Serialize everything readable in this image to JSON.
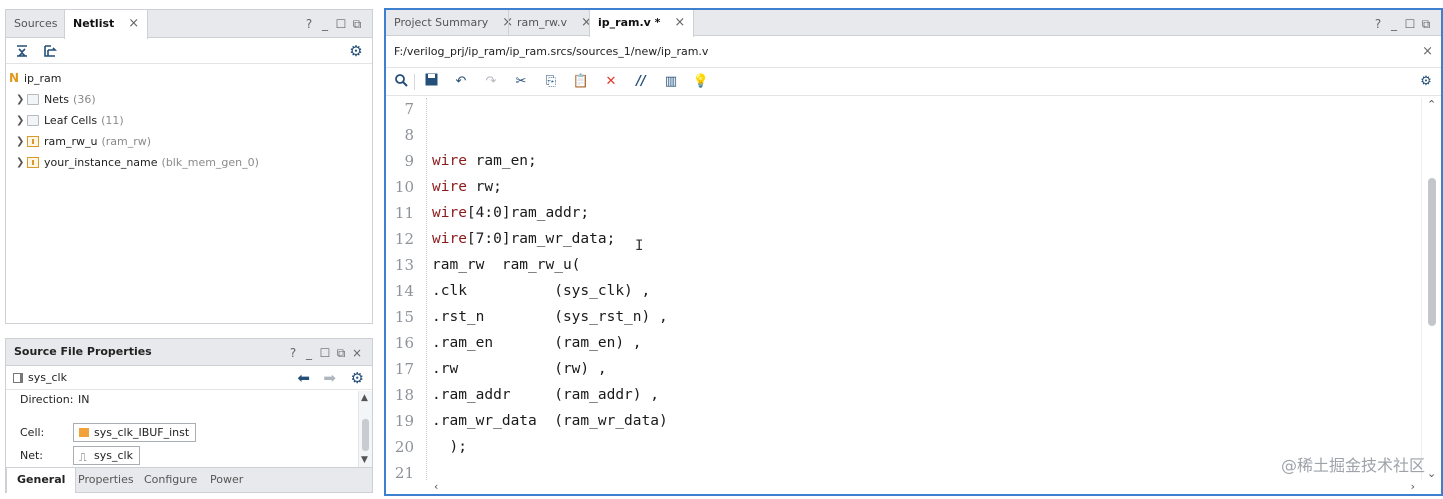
{
  "left_top": {
    "tabs": [
      {
        "label": "Sources"
      },
      {
        "label": "Netlist"
      }
    ],
    "close_glyph": "×",
    "window_controls": [
      "?",
      "_",
      "☐",
      "⧉"
    ],
    "tree": {
      "root": "ip_ram",
      "items": [
        {
          "label": "Nets",
          "count": "(36)",
          "icon": "folder-icon"
        },
        {
          "label": "Leaf Cells",
          "count": "(11)",
          "icon": "folder-icon"
        },
        {
          "label": "ram_rw_u",
          "count": "(ram_rw)",
          "icon": "cell-icon"
        },
        {
          "label": "your_instance_name",
          "count": "(blk_mem_gen_0)",
          "icon": "cell-icon"
        }
      ]
    }
  },
  "props": {
    "title": "Source File Properties",
    "window_controls": [
      "?",
      "_",
      "☐",
      "⧉",
      "×"
    ],
    "object": "sys_clk",
    "rows": {
      "direction_label": "Direction:",
      "direction_value": "IN",
      "cell_label": "Cell:",
      "cell_value": "sys_clk_IBUF_inst",
      "net_label": "Net:",
      "net_value": "sys_clk"
    },
    "tabs": [
      "General",
      "Properties",
      "Configure",
      "Power"
    ]
  },
  "editor": {
    "tabs": [
      {
        "label": "Project Summary"
      },
      {
        "label": "ram_rw.v"
      },
      {
        "label": "ip_ram.v *"
      }
    ],
    "window_controls": [
      "?",
      "_",
      "☐",
      "⧉"
    ],
    "path": "F:/verilog_prj/ip_ram/ip_ram.srcs/sources_1/new/ip_ram.v",
    "lines": [
      {
        "n": "7",
        "kw": "",
        "rest": ""
      },
      {
        "n": "8",
        "kw": "",
        "rest": ""
      },
      {
        "n": "9",
        "kw": "wire",
        "rest": " ram_en;"
      },
      {
        "n": "10",
        "kw": "wire",
        "rest": " rw;"
      },
      {
        "n": "11",
        "kw": "wire",
        "rest": "[4:0]ram_addr;"
      },
      {
        "n": "12",
        "kw": "wire",
        "rest": "[7:0]ram_wr_data;"
      },
      {
        "n": "13",
        "kw": "",
        "rest": "ram_rw  ram_rw_u("
      },
      {
        "n": "14",
        "kw": "",
        "rest": ".clk          (sys_clk) ,"
      },
      {
        "n": "15",
        "kw": "",
        "rest": ".rst_n        (sys_rst_n) ,"
      },
      {
        "n": "16",
        "kw": "",
        "rest": ".ram_en       (ram_en) ,"
      },
      {
        "n": "17",
        "kw": "",
        "rest": ".rw           (rw) ,"
      },
      {
        "n": "18",
        "kw": "",
        "rest": ".ram_addr     (ram_addr) ,"
      },
      {
        "n": "19",
        "kw": "",
        "rest": ".ram_wr_data  (ram_wr_data)"
      },
      {
        "n": "20",
        "kw": "",
        "rest": "  );"
      },
      {
        "n": "21",
        "kw": "",
        "rest": ""
      }
    ]
  },
  "watermark": "@稀土掘金技术社区"
}
